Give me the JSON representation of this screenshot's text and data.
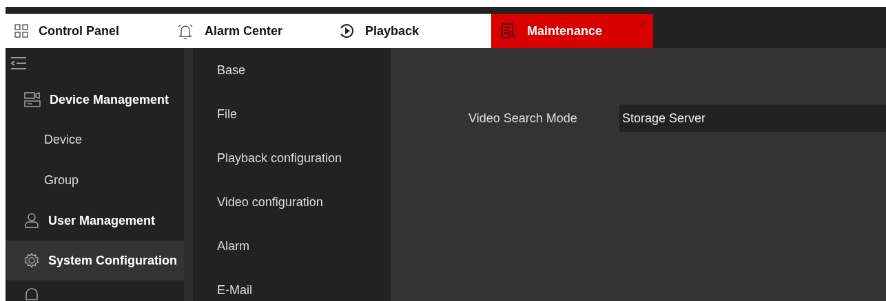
{
  "tabs": [
    {
      "label": "Control Panel",
      "kind": "grid",
      "selected": false
    },
    {
      "label": "Alarm Center",
      "kind": "bell",
      "selected": false
    },
    {
      "label": "Playback",
      "kind": "play",
      "selected": false
    },
    {
      "label": "Maintenance",
      "kind": "maintenance",
      "selected": true,
      "close": "×"
    }
  ],
  "sidebar": {
    "items": [
      {
        "label": "Device Management",
        "kind": "device",
        "selected": false,
        "children": [
          {
            "label": "Device"
          },
          {
            "label": "Group"
          }
        ]
      },
      {
        "label": "User Management",
        "kind": "user",
        "selected": false
      },
      {
        "label": "System Configuration",
        "kind": "gear",
        "selected": true
      },
      {
        "kind": "alarm",
        "selected": false
      }
    ]
  },
  "submenu": {
    "items": [
      {
        "label": "Base"
      },
      {
        "label": "File"
      },
      {
        "label": "Playback configuration"
      },
      {
        "label": "Video configuration"
      },
      {
        "label": "Alarm"
      },
      {
        "label": "E-Mail"
      }
    ]
  },
  "form": {
    "fields": [
      {
        "label": "Video Search Mode",
        "value": "Storage Server"
      }
    ]
  }
}
